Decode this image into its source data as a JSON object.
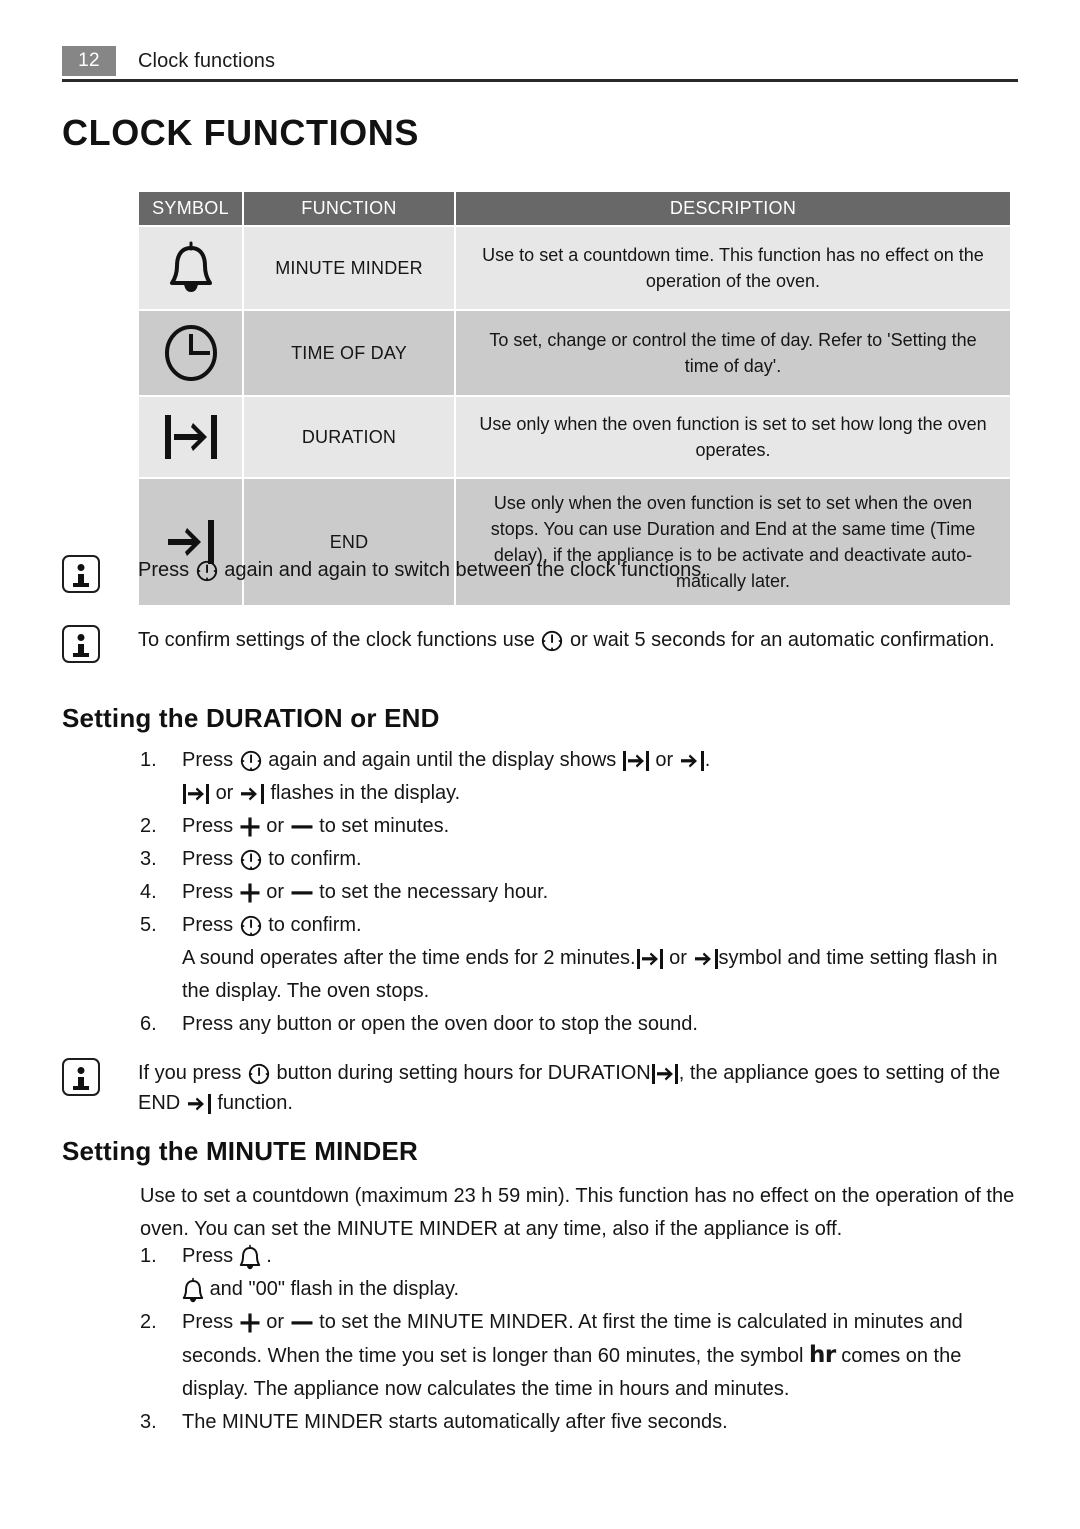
{
  "header": {
    "page_number": "12",
    "running_title": "Clock functions"
  },
  "chapter_title": "CLOCK FUNCTIONS",
  "table": {
    "columns": [
      "SYMBOL",
      "FUNCTION",
      "DESCRIPTION"
    ],
    "rows": [
      {
        "symbol_icon": "bell-icon",
        "function": "MINUTE MINDER",
        "description": "Use to set a countdown time. This function has no effect on the operation of the oven."
      },
      {
        "symbol_icon": "clock-icon",
        "function": "TIME OF DAY",
        "description": "To set, change or control the time of day. Refer to 'Setting the time of day'."
      },
      {
        "symbol_icon": "duration-icon",
        "function": "DURATION",
        "description": "Use only when the oven function is set to set how long the oven operates."
      },
      {
        "symbol_icon": "end-icon",
        "function": "END",
        "description": "Use only when the oven function is set to set when the oven stops. You can use Duration and End at the same time (Time delay), if the appliance is to be activate and deactivate auto-matically later."
      }
    ]
  },
  "notes": [
    {
      "icon": "info-icon",
      "text_before": "Press",
      "inline_icon": "clock-button-icon",
      "text_after": "again and again to switch between the clock functions."
    },
    {
      "icon": "info-icon",
      "text_before": "To confirm settings of the clock functions use",
      "inline_icon": "clock-button-icon",
      "text_after": "or wait 5 seconds for an automatic confirmation."
    },
    {
      "icon": "info-icon",
      "text_a": "If you press",
      "inline_icon_1": "clock-button-icon",
      "text_b": "button during setting hours for DURATION",
      "inline_icon_2": "duration-icon",
      "text_c": ", the appliance goes to setting of the END",
      "inline_icon_3": "end-icon",
      "text_d": "function."
    }
  ],
  "section_duration": {
    "heading": "Setting the DURATION or END",
    "steps": [
      {
        "num": "1.",
        "text_a": "Press",
        "icon_1": "clock-button-icon",
        "text_b": "again and again until the display shows",
        "icon_2": "duration-icon",
        "text_c": "or",
        "icon_3": "end-icon",
        "text_d": "."
      },
      {
        "num": "",
        "continuation": true,
        "icon_1": "duration-icon",
        "text_b": "or",
        "icon_2": "end-icon",
        "text_c": "flashes in the display."
      },
      {
        "num": "2.",
        "text_a": "Press",
        "icon_1": "plus-icon",
        "text_b": "or",
        "icon_2": "minus-icon",
        "text_c": "to set minutes."
      },
      {
        "num": "3.",
        "text_a": "Press",
        "icon_1": "clock-button-icon",
        "text_b": "to confirm."
      },
      {
        "num": "4.",
        "text_a": "Press",
        "icon_1": "plus-icon",
        "text_b": "or",
        "icon_2": "minus-icon",
        "text_c": "to set the necessary hour."
      },
      {
        "num": "5.",
        "text_a": "Press",
        "icon_1": "clock-button-icon",
        "text_b": "to confirm."
      },
      {
        "num": "",
        "continuation": true,
        "text_a": "A sound operates after the time ends for 2 minutes.",
        "icon_1": "duration-icon",
        "text_b": "or",
        "icon_2": "end-icon",
        "text_c": "symbol and time setting flash in the display. The oven stops."
      },
      {
        "num": "6.",
        "text_a": "Press any button or open the oven door to stop the sound."
      }
    ]
  },
  "section_minute_minder": {
    "heading": "Setting the MINUTE MINDER",
    "intro": "Use to set a countdown (maximum 23 h 59 min). This function has no effect on the operation of the oven. You can set the MINUTE MINDER at any time, also if the appliance is off.",
    "steps": [
      {
        "num": "1.",
        "text_a": "Press",
        "icon_1": "bell-icon",
        "text_b": "."
      },
      {
        "num": "",
        "continuation": true,
        "icon_1": "bell-icon",
        "text_b": "and \"00\" flash in the display."
      },
      {
        "num": "2.",
        "text_a": "Press",
        "icon_1": "plus-icon",
        "text_b": "or",
        "icon_2": "minus-icon",
        "text_c": "to set the MINUTE MINDER. At first the time is calculated in minutes and seconds. When the time you set is longer than 60 minutes, the symbol",
        "icon_3": "hr-symbol",
        "hr_text": "hr",
        "text_d": "comes on the display. The appliance now calculates the time in hours and minutes."
      },
      {
        "num": "3.",
        "text_a": "The MINUTE MINDER starts automatically after five seconds."
      }
    ]
  },
  "colors": {
    "header_band": "#868686",
    "table_header": "#686868",
    "row_light": "#e7e7e7",
    "row_dark": "#cbcbcb",
    "text": "#161616"
  }
}
